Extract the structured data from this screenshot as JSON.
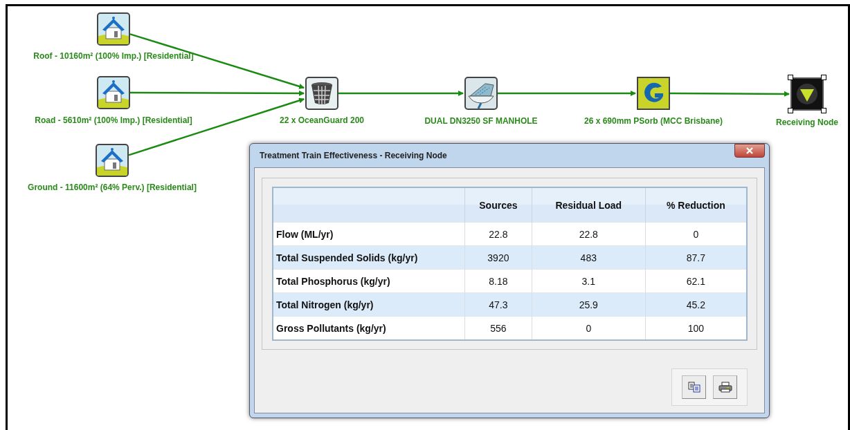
{
  "nodes": [
    {
      "kind": "house",
      "label": "Roof - 10160m² (100% Imp.) [Residential]",
      "selected": false
    },
    {
      "kind": "house",
      "label": "Road - 5610m² (100% Imp.) [Residential]",
      "selected": false
    },
    {
      "kind": "house",
      "label": "Ground - 11600m² (64% Perv.) [Residential]",
      "selected": false
    },
    {
      "kind": "basket",
      "label": "22 x OceanGuard 200",
      "selected": false
    },
    {
      "kind": "manhole",
      "label": "DUAL DN3250 SF MANHOLE",
      "selected": false
    },
    {
      "kind": "filter",
      "label": "26 x 690mm PSorb (MCC Brisbane)",
      "selected": false
    },
    {
      "kind": "receiving",
      "label": "Receiving Node",
      "selected": true
    }
  ],
  "dialog": {
    "title": "Treatment Train Effectiveness - Receiving Node",
    "table": {
      "columns": [
        "",
        "Sources",
        "Residual Load",
        "% Reduction"
      ],
      "rows": [
        [
          "Flow (ML/yr)",
          "22.8",
          "22.8",
          "0"
        ],
        [
          "Total Suspended Solids (kg/yr)",
          "3920",
          "483",
          "87.7"
        ],
        [
          "Total Phosphorus (kg/yr)",
          "8.18",
          "3.1",
          "62.1"
        ],
        [
          "Total Nitrogen (kg/yr)",
          "47.3",
          "25.9",
          "45.2"
        ],
        [
          "Gross Pollutants (kg/yr)",
          "556",
          "0",
          "100"
        ]
      ]
    },
    "buttons": [
      {
        "kind": "copy"
      },
      {
        "kind": "print"
      }
    ]
  }
}
